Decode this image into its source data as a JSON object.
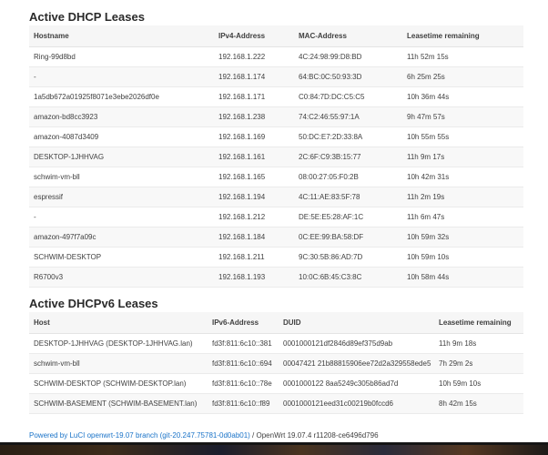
{
  "dhcp": {
    "title": "Active DHCP Leases",
    "columns": [
      "Hostname",
      "IPv4-Address",
      "MAC-Address",
      "Leasetime remaining"
    ],
    "rows": [
      [
        "Ring-99d8bd",
        "192.168.1.222",
        "4C:24:98:99:D8:BD",
        "11h 52m 15s"
      ],
      [
        "-",
        "192.168.1.174",
        "64:BC:0C:50:93:3D",
        "6h 25m 25s"
      ],
      [
        "1a5db672a01925f8071e3ebe2026df0e",
        "192.168.1.171",
        "C0:84:7D:DC:C5:C5",
        "10h 36m 44s"
      ],
      [
        "amazon-bd8cc3923",
        "192.168.1.238",
        "74:C2:46:55:97:1A",
        "9h 47m 57s"
      ],
      [
        "amazon-4087d3409",
        "192.168.1.169",
        "50:DC:E7:2D:33:8A",
        "10h 55m 55s"
      ],
      [
        "DESKTOP-1JHHVAG",
        "192.168.1.161",
        "2C:6F:C9:3B:15:77",
        "11h 9m 17s"
      ],
      [
        "schwim-vm-bll",
        "192.168.1.165",
        "08:00:27:05:F0:2B",
        "10h 42m 31s"
      ],
      [
        "espressif",
        "192.168.1.194",
        "4C:11:AE:83:5F:78",
        "11h 2m 19s"
      ],
      [
        "-",
        "192.168.1.212",
        "DE:5E:E5:28:AF:1C",
        "11h 6m 47s"
      ],
      [
        "amazon-497f7a09c",
        "192.168.1.184",
        "0C:EE:99:BA:58:DF",
        "10h 59m 32s"
      ],
      [
        "SCHWIM-DESKTOP",
        "192.168.1.211",
        "9C:30:5B:86:AD:7D",
        "10h 59m 10s"
      ],
      [
        "R6700v3",
        "192.168.1.193",
        "10:0C:6B:45:C3:8C",
        "10h 58m 44s"
      ]
    ]
  },
  "dhcpv6": {
    "title": "Active DHCPv6 Leases",
    "columns": [
      "Host",
      "IPv6-Address",
      "DUID",
      "Leasetime remaining"
    ],
    "rows": [
      [
        "DESKTOP-1JHHVAG (DESKTOP-1JHHVAG.lan)",
        "fd3f:811:6c10::381",
        "0001000121df2846d89ef375d9ab",
        "11h 9m 18s"
      ],
      [
        "schwim-vm-bll",
        "fd3f:811:6c10::694",
        "00047421 21b88815906ee72d2a329558ede5",
        "7h 29m 2s"
      ],
      [
        "SCHWIM-DESKTOP (SCHWIM-DESKTOP.lan)",
        "fd3f:811:6c10::78e",
        "0001000122 8aa5249c305b86ad7d",
        "10h 59m 10s"
      ],
      [
        "SCHWIM-BASEMENT (SCHWIM-BASEMENT.lan)",
        "fd3f:811:6c10::f89",
        "0001000121eed31c00219b0fccd6",
        "8h 42m 15s"
      ]
    ]
  },
  "footer": {
    "link_text": "Powered by LuCI openwrt-19.07 branch (git-20.247.75781-0d0ab01)",
    "version_text": " / OpenWrt 19.07.4 r11208-ce6496d796"
  },
  "colors": {
    "link": "#1a73c8",
    "header_bg": "#f6f6f6",
    "stripe_bg": "#f8f8f8"
  }
}
